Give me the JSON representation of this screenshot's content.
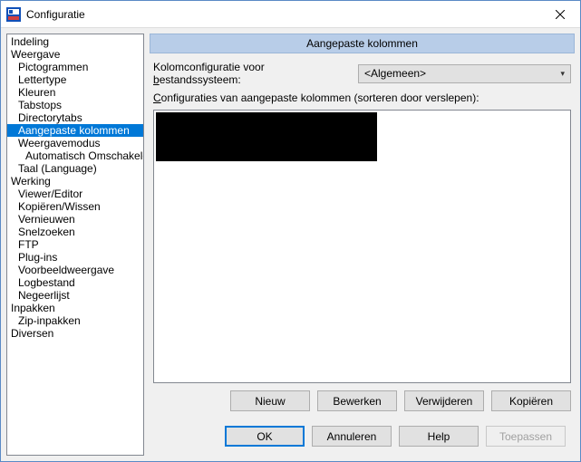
{
  "window": {
    "title": "Configuratie"
  },
  "tree": {
    "items": [
      {
        "label": "Indeling",
        "level": 0
      },
      {
        "label": "Weergave",
        "level": 0
      },
      {
        "label": "Pictogrammen",
        "level": 1
      },
      {
        "label": "Lettertype",
        "level": 1
      },
      {
        "label": "Kleuren",
        "level": 1
      },
      {
        "label": "Tabstops",
        "level": 1
      },
      {
        "label": "Directorytabs",
        "level": 1
      },
      {
        "label": "Aangepaste kolommen",
        "level": 1,
        "selected": true
      },
      {
        "label": "Weergavemodus",
        "level": 1
      },
      {
        "label": "Automatisch Omschakelen M",
        "level": 2
      },
      {
        "label": "Taal (Language)",
        "level": 1
      },
      {
        "label": "Werking",
        "level": 0
      },
      {
        "label": "Viewer/Editor",
        "level": 1
      },
      {
        "label": "Kopiëren/Wissen",
        "level": 1
      },
      {
        "label": "Vernieuwen",
        "level": 1
      },
      {
        "label": "Snelzoeken",
        "level": 1
      },
      {
        "label": "FTP",
        "level": 1
      },
      {
        "label": "Plug-ins",
        "level": 1
      },
      {
        "label": "Voorbeeldweergave",
        "level": 1
      },
      {
        "label": "Logbestand",
        "level": 1
      },
      {
        "label": "Negeerlijst",
        "level": 1
      },
      {
        "label": "Inpakken",
        "level": 0
      },
      {
        "label": "Zip-inpakken",
        "level": 1
      },
      {
        "label": "Diversen",
        "level": 0
      }
    ]
  },
  "panel": {
    "header": "Aangepaste kolommen",
    "filesystem_label_pre": "Kolomconfiguratie voor ",
    "filesystem_label_accel": "b",
    "filesystem_label_post": "estandssysteem:",
    "filesystem_value": "<Algemeen>",
    "configs_label_pre": "",
    "configs_label_accel": "C",
    "configs_label_post": "onfiguraties van aangepaste kolommen (sorteren door verslepen):",
    "buttons": {
      "new": "Nieuw",
      "edit": "Bewerken",
      "delete": "Verwijderen",
      "copy": "Kopiëren"
    }
  },
  "footer": {
    "ok": "OK",
    "cancel": "Annuleren",
    "help": "Help",
    "apply": "Toepassen"
  }
}
